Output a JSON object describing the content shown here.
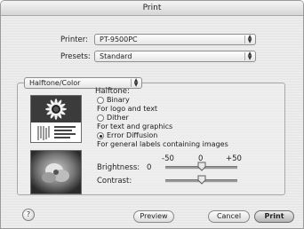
{
  "window": {
    "title": "Print"
  },
  "printer": {
    "label": "Printer:",
    "value": "PT-9500PC"
  },
  "presets": {
    "label": "Presets:",
    "value": "Standard"
  },
  "panel": {
    "value": "Halftone/Color"
  },
  "halftone": {
    "label": "Halftone:",
    "options": [
      {
        "label": "Binary",
        "sub": "For logo and text",
        "selected": false
      },
      {
        "label": "Dither",
        "sub": "For text and graphics",
        "selected": false
      },
      {
        "label": "Error Diffusion",
        "sub": "For general labels containing images",
        "selected": true
      }
    ]
  },
  "scale": {
    "min": "-50",
    "mid": "0",
    "max": "+50"
  },
  "brightness": {
    "label": "Brightness:",
    "value": "0",
    "level": 0
  },
  "contrast": {
    "label": "Contrast:",
    "value": "",
    "level": 0
  },
  "buttons": {
    "help": "?",
    "preview": "Preview",
    "cancel": "Cancel",
    "print": "Print"
  },
  "icons": [
    "updown-arrows-icon",
    "help-icon",
    "radio-icon",
    "slider-knob-icon"
  ]
}
